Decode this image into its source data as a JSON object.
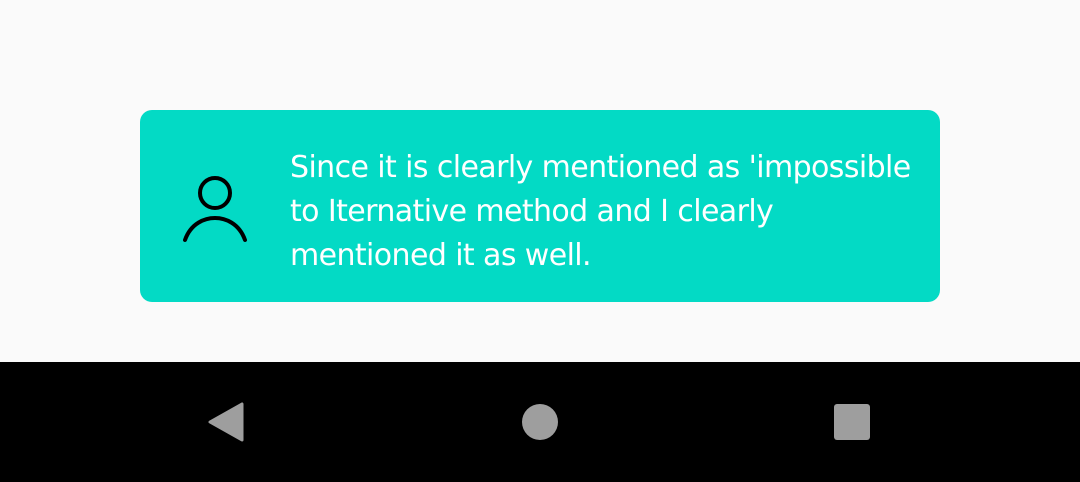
{
  "message": {
    "text": "Since it is clearly mentioned as 'impossible to Iternative method and I clearly mentioned it as well."
  },
  "icons": {
    "avatar": "person-outline-icon",
    "nav_back": "back-triangle-icon",
    "nav_home": "home-circle-icon",
    "nav_recents": "recents-square-icon"
  },
  "colors": {
    "background": "#fafafa",
    "card": "#03dac5",
    "card_text": "#ffffff",
    "nav_bar": "#000000",
    "nav_icons": "#9e9e9e"
  }
}
